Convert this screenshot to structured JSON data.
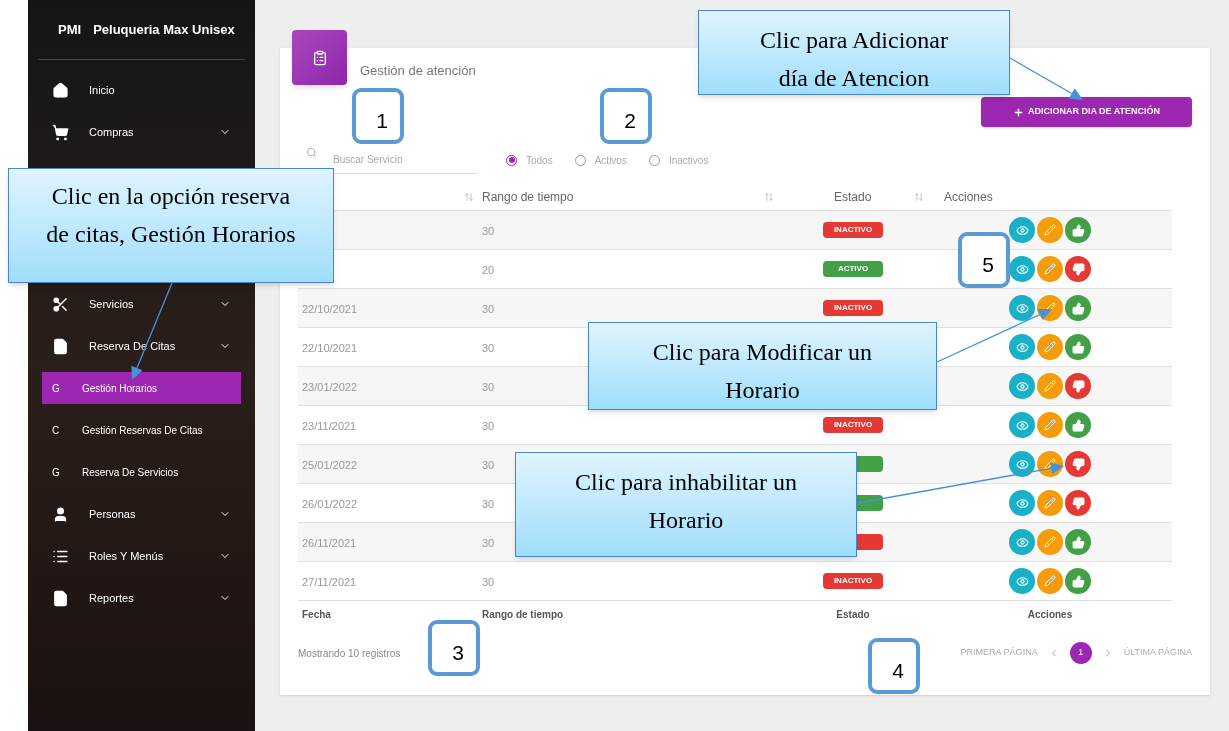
{
  "sidebar": {
    "logo": "PMI",
    "brand": "Peluqueria Max Unisex",
    "items": [
      {
        "label": "Inicio",
        "submenu": false,
        "selected": false
      },
      {
        "label": "Compras",
        "submenu": true,
        "selected": false
      },
      {
        "label": "Servicios",
        "submenu": true,
        "selected": false
      },
      {
        "label": "Reserva De Citas",
        "submenu": true,
        "selected": false,
        "children": [
          {
            "abbr": "G",
            "label": "Gestión Horarios",
            "selected": true
          },
          {
            "abbr": "C",
            "label": "Gestión Reservas De Citas",
            "selected": false
          },
          {
            "abbr": "G",
            "label": "Reserva De Servicios",
            "selected": false
          }
        ]
      },
      {
        "label": "Personas",
        "submenu": true,
        "selected": false
      },
      {
        "label": "Roles Y Menús",
        "submenu": true,
        "selected": false
      },
      {
        "label": "Reportes",
        "submenu": true,
        "selected": false
      }
    ]
  },
  "page": {
    "title": "Gestión de atención",
    "add_button": "ADICIONAR DIA DE ATENCIÓN",
    "search": {
      "placeholder": "Buscar Servicio"
    },
    "filters": [
      {
        "label": "Todos",
        "selected": true
      },
      {
        "label": "Activos",
        "selected": false
      },
      {
        "label": "Inactivos",
        "selected": false
      }
    ],
    "table": {
      "columns": [
        {
          "sortable": true
        },
        {
          "label": "Rango de tiempo",
          "sortable": true
        },
        {
          "label": "Estado",
          "sortable": true
        },
        {
          "label": "Acciones"
        }
      ],
      "rows": [
        {
          "range": "30",
          "status": {
            "label": "INACTIVO",
            "active": false
          },
          "can_enable": true
        },
        {
          "range": "20",
          "status": {
            "label": "ACTIVO",
            "active": true
          },
          "can_enable": false
        },
        {
          "date": "22/10/2021",
          "range": "30",
          "status": {
            "label": "INACTIVO",
            "active": false
          },
          "can_enable": true
        },
        {
          "date": "22/10/2021",
          "range": "30",
          "can_enable": true
        },
        {
          "date": "23/01/2022",
          "range": "30",
          "can_enable": false
        },
        {
          "date": "23/11/2021",
          "range": "30",
          "status": {
            "label": "INACTIVO",
            "active": false
          },
          "can_enable": true
        },
        {
          "date": "25/01/2022",
          "range": "30",
          "status": {
            "active": true
          },
          "can_enable": false
        },
        {
          "date": "26/01/2022",
          "range": "30",
          "status": {
            "active": true
          },
          "can_enable": false
        },
        {
          "date": "26/11/2021",
          "range": "30",
          "status": {
            "active": false
          },
          "can_enable": true
        },
        {
          "date": "27/11/2021",
          "range": "30",
          "status": {
            "label": "INACTIVO",
            "active": false
          },
          "can_enable": true
        }
      ],
      "footer": [
        "Fecha",
        "Rango de tiempo",
        "Estado",
        "Acciones"
      ]
    },
    "count": "Mostrando 10 registros",
    "pagination": {
      "first": "PRIMERA PÁGINA",
      "pages": [
        {
          "label": "1",
          "selected": true
        }
      ],
      "last": "ÚLTIMA PÁGINA"
    }
  },
  "callouts": [
    {
      "text": "Clic para Adicionar día de Atencion"
    },
    {
      "text": "Clic en la opción reserva de citas, Gestión Horarios"
    },
    {
      "text": "Clic para Modificar un Horario"
    },
    {
      "text": "Clic para inhabilitar un Horario"
    }
  ],
  "markers": [
    "1",
    "2",
    "3",
    "4",
    "5"
  ]
}
